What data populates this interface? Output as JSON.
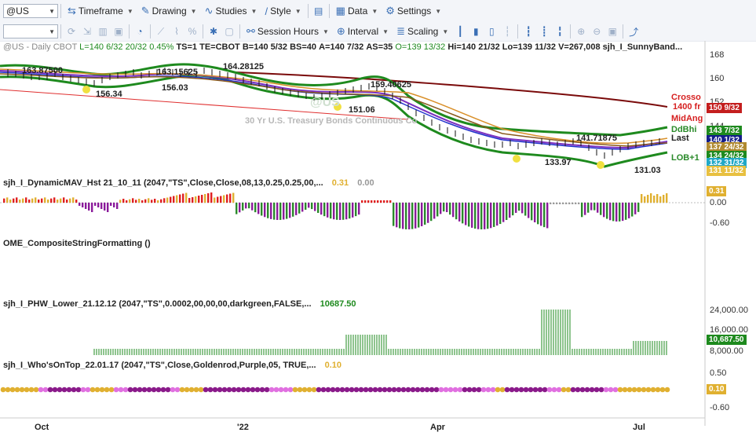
{
  "toolbar1": {
    "symbol": "@US",
    "timeframe": "Timeframe",
    "drawing": "Drawing",
    "studies": "Studies",
    "style": "Style",
    "data": "Data",
    "settings": "Settings"
  },
  "toolbar2": {
    "session_hours": "Session Hours",
    "interval": "Interval",
    "scaling": "Scaling"
  },
  "main_pane": {
    "header": {
      "symbol": "@US - Daily",
      "exchange": "CBOT",
      "last": "L=140 6/32",
      "change": "20/32",
      "pct": "0.45%",
      "ts": "TS=1",
      "te": "TE=CBOT",
      "bid": "B=140 5/32",
      "bs": "BS=40",
      "ask": "A=140 7/32",
      "as": "AS=35",
      "open": "O=139 13/32",
      "high": "Hi=140 21/32",
      "low": "Lo=139 11/32",
      "vol": "V=267,008",
      "study": "sjh_I_SunnyBand..."
    },
    "watermark": "30 Yr U.S. Treasury Bonds Continuous Co",
    "logo_text": "@US",
    "data_labels": [
      "163.87500",
      "156.34",
      "163.15625",
      "156.03",
      "164.28125",
      "151.06",
      "159.40625",
      "141.71875",
      "133.97",
      "131.03"
    ],
    "right_labels": [
      "Crosso",
      "1400 fr",
      "MidAng",
      "DdBhi",
      "Last",
      "LOB+1"
    ],
    "price_axis": [
      "168",
      "160",
      "152",
      "144"
    ],
    "tags": [
      "150 9/32",
      "143 7/32",
      "140 1/32",
      "137 24/32",
      "134 24/32",
      "132 31/32",
      "131 11/32"
    ]
  },
  "pane2": {
    "title": "sjh_I_DynamicMAV_Hst 21_10_11 (2047,\"TS\",Close,Close,08,13,0.25,0.25,00,...",
    "value1": "0.31",
    "value2": "0.00",
    "axis": [
      "0.00",
      "-0.60"
    ],
    "tag": "0.31"
  },
  "pane3": {
    "title": "OME_CompositeStringFormatting ()"
  },
  "pane4": {
    "title": "sjh_I_PHW_Lower_21.12.12 (2047,\"TS\",0.0002,00,00,00,darkgreen,FALSE,...",
    "value": "10687.50",
    "axis": [
      "24,000.00",
      "16,000.00",
      "8,000.00"
    ],
    "tag": "10,687.50"
  },
  "pane5": {
    "title": "sjh_I_Who'sOnTop_22.01.17 (2047,\"TS\",Close,Goldenrod,Purple,05, TRUE,...",
    "value": "0.10",
    "axis": [
      "0.50",
      "-0.60"
    ],
    "tag": "0.10"
  },
  "x_axis": [
    "Oct",
    "'22",
    "Apr",
    "Jul"
  ],
  "colors": {
    "band_green": "#1e8a1e",
    "ma_purple": "#7b2fbf",
    "ma_blue": "#2233cc",
    "ma_orange": "#d9902a",
    "ma_brown": "#8a5a1c",
    "long_ma": "#7a0a0a",
    "trend": "#e03030",
    "hist_red": "#e02020",
    "hist_gold": "#e0b030",
    "hist_green": "#2a8a2a",
    "hist_purple": "#8a1a9a",
    "hist_gray": "#9a9a9a",
    "dot_purple": "#8a1a8a",
    "dot_pink": "#e070e0",
    "dot_gold": "#e0b030"
  }
}
